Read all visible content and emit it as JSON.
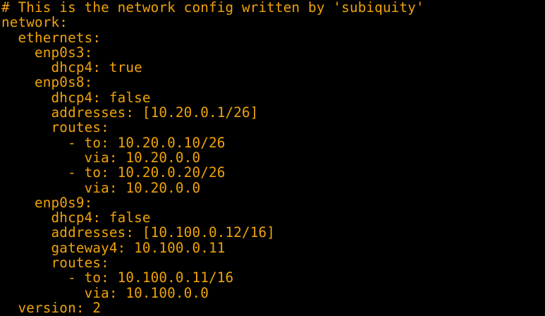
{
  "terminal": {
    "text_color": "#F0A30A",
    "background_color": "#000000",
    "lines": [
      "# This is the network config written by 'subiquity'",
      "network:",
      "  ethernets:",
      "    enp0s3:",
      "      dhcp4: true",
      "    enp0s8:",
      "      dhcp4: false",
      "      addresses: [10.20.0.1/26]",
      "      routes:",
      "        - to: 10.20.0.10/26",
      "          via: 10.20.0.0",
      "        - to: 10.20.0.20/26",
      "          via: 10.20.0.0",
      "    enp0s9:",
      "      dhcp4: false",
      "      addresses: [10.100.0.12/16]",
      "      gateway4: 10.100.0.11",
      "      routes:",
      "        - to: 10.100.0.11/16",
      "          via: 10.100.0.0",
      "  version: 2"
    ]
  }
}
